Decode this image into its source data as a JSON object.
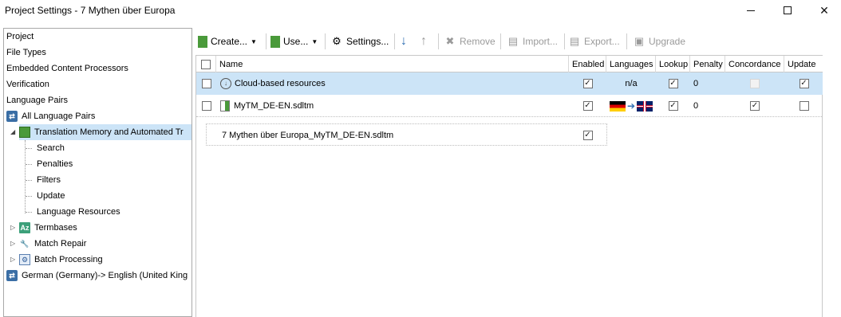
{
  "window": {
    "title": "Project Settings - 7 Mythen über Europa"
  },
  "tree": {
    "items": [
      {
        "label": "Project"
      },
      {
        "label": "File Types"
      },
      {
        "label": "Embedded Content Processors"
      },
      {
        "label": "Verification"
      },
      {
        "label": "Language Pairs"
      },
      {
        "label": "All Language Pairs"
      },
      {
        "label": "Translation Memory and Automated Tr"
      },
      {
        "label": "Search"
      },
      {
        "label": "Penalties"
      },
      {
        "label": "Filters"
      },
      {
        "label": "Update"
      },
      {
        "label": "Language Resources"
      },
      {
        "label": "Termbases"
      },
      {
        "label": "Match Repair"
      },
      {
        "label": "Batch Processing"
      },
      {
        "label": "German (Germany)-> English (United King"
      }
    ]
  },
  "toolbar": {
    "create": "Create...",
    "use": "Use...",
    "settings": "Settings...",
    "remove": "Remove",
    "import": "Import...",
    "export": "Export...",
    "upgrade": "Upgrade"
  },
  "grid": {
    "columns": [
      "Name",
      "Enabled",
      "Languages",
      "Lookup",
      "Penalty",
      "Concordance",
      "Update"
    ],
    "rows": [
      {
        "name": "Cloud-based resources",
        "enabled": true,
        "languages": "n/a",
        "lookup": true,
        "penalty": "0",
        "concordance": "disabled",
        "update": true
      },
      {
        "name": "MyTM_DE-EN.sdltm",
        "enabled": true,
        "languages": "de-DE → en-GB",
        "lookup": true,
        "penalty": "0",
        "concordance": true,
        "update": false
      }
    ],
    "subrow": {
      "name": "7 Mythen über Europa_MyTM_DE-EN.sdltm",
      "enabled": true
    }
  },
  "colors": {
    "selection": "#cce4f7",
    "accent": "#2f6fb3"
  }
}
